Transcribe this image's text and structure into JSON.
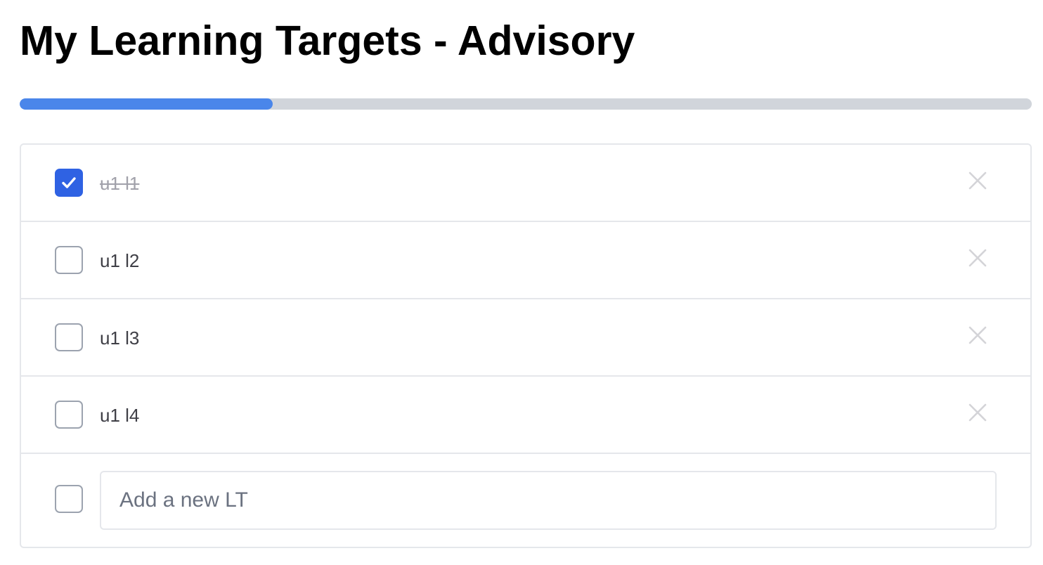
{
  "page": {
    "title": "My Learning Targets - Advisory"
  },
  "progress": {
    "fraction": 0.25,
    "fill_color": "#4a86ea",
    "track_color": "#d1d5db"
  },
  "targets": [
    {
      "label": "u1 l1",
      "checked": true
    },
    {
      "label": "u1 l2",
      "checked": false
    },
    {
      "label": "u1 l3",
      "checked": false
    },
    {
      "label": "u1 l4",
      "checked": false
    }
  ],
  "new_target": {
    "placeholder": "Add a new LT",
    "value": ""
  },
  "colors": {
    "checkbox_checked": "#2f62e3",
    "delete_icon": "#d4d4d8"
  },
  "icons": {
    "check": "check-icon",
    "delete": "close-icon"
  }
}
